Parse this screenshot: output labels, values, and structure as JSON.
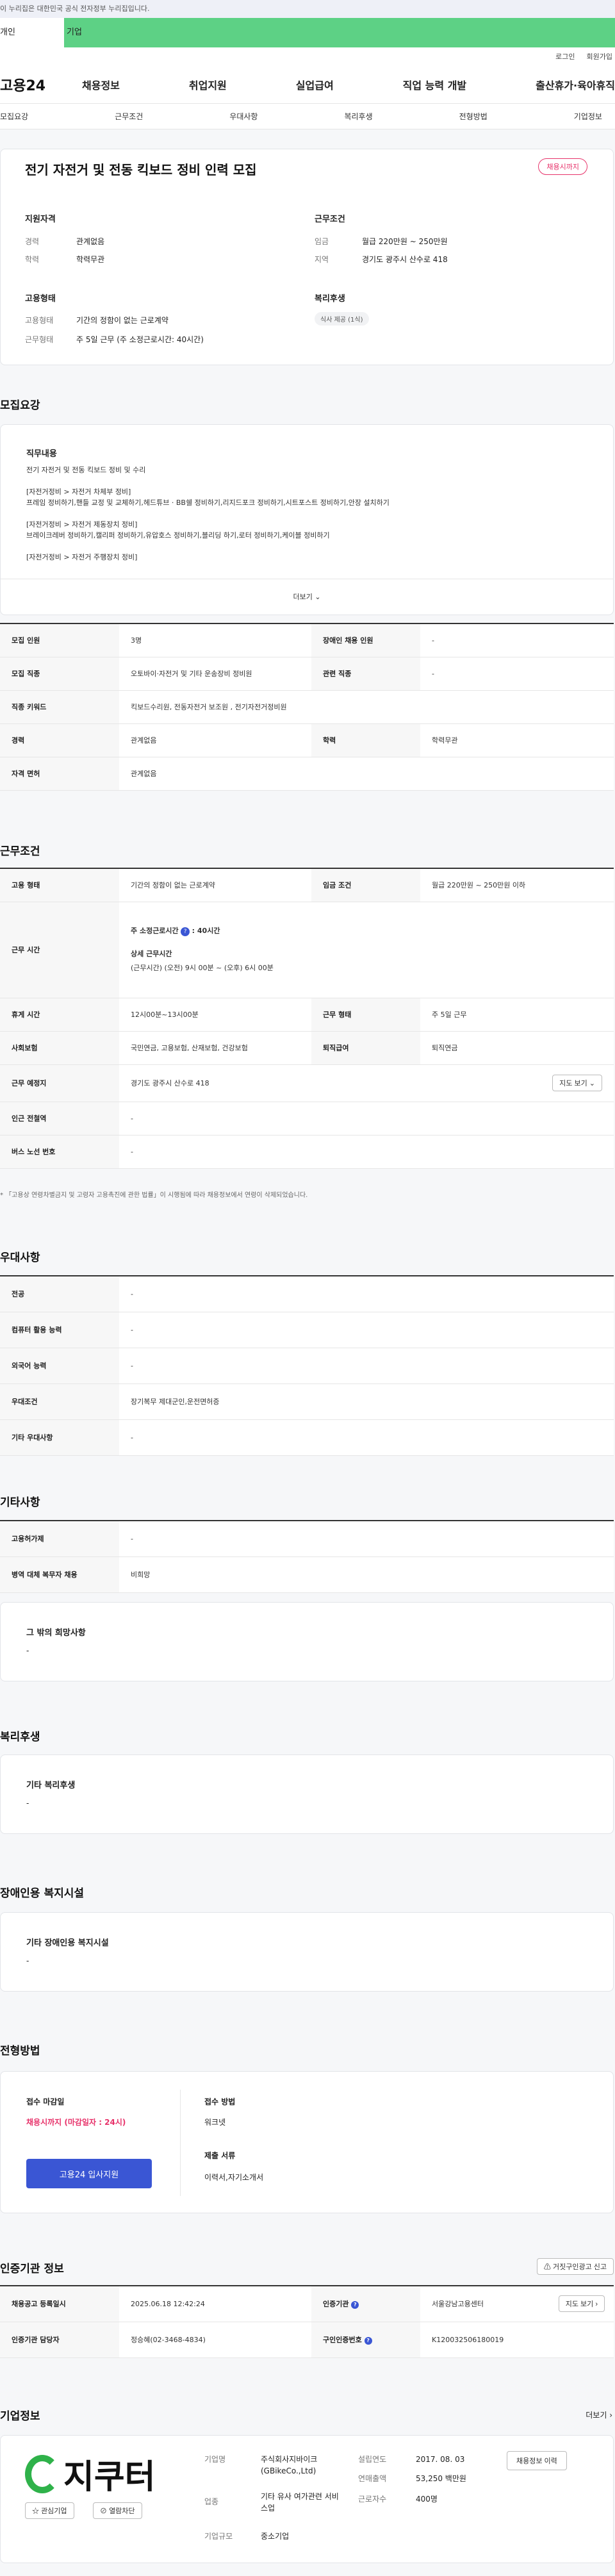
{
  "gov_banner": "이 누리집은 대한민국 공식 전자정부 누리집입니다.",
  "site_tabs": [
    "개인",
    "기업"
  ],
  "utility": [
    "로그인",
    "회원가입"
  ],
  "gnb": {
    "logo": "고용24",
    "menu": [
      "채용정보",
      "취업지원",
      "실업급여",
      "직업 능력 개발",
      "출산휴가·육아휴직"
    ]
  },
  "snb": [
    "모집요강",
    "근무조건",
    "우대사항",
    "복리후생",
    "전형방법",
    "기업정보"
  ],
  "summary": {
    "title": "전기 자전거 및 전동 킥보드 정비 인력 모집",
    "badge": "채용시까지",
    "qual_title": "지원자격",
    "qual": [
      {
        "k": "경력",
        "v": "관계없음"
      },
      {
        "k": "학력",
        "v": "학력무관"
      }
    ],
    "cond_title": "근무조건",
    "cond": [
      {
        "k": "임금",
        "v": "월급 220만원 ~ 250만원"
      },
      {
        "k": "지역",
        "v": "경기도 광주시 산수로 418"
      }
    ],
    "emp_title": "고용형태",
    "emp": [
      {
        "k": "고용형태",
        "v": "기간의 정함이 없는 근로계약"
      },
      {
        "k": "근무형태",
        "v": "주 5일 근무 (주 소정근로시간: 40시간)"
      }
    ],
    "welfare_title": "복리후생",
    "welfare_tag": "식사 제공 (1식)"
  },
  "recruit": {
    "title": "모집요강",
    "duty_title": "직무내용",
    "duty_lines": [
      "전기 자전거 및 전동 킥보드 정비 및 수리",
      "",
      "[자전거정비 > 자전거 차체부 정비]",
      "프레임 정비하기,핸들 교정 및 교체하기,헤드튜브 · BB쉘 정비하기,리지드포크 정비하기,시트포스트 정비하기,안장 설치하기",
      "",
      "[자전거정비 > 자전거 제동장치 정비]",
      "브레이크레버 정비하기,캘리퍼 정비하기,유압호스 정비하기,블리딩 하기,로터 정비하기,케이블 정비하기",
      "",
      "[자전거정비 > 자전거 주행장치 정비]"
    ],
    "more": "더보기",
    "table": [
      {
        "k1": "모집 인원",
        "v1": "3명",
        "k2": "장애인 채용 인원",
        "v2": "-"
      },
      {
        "k1": "모집 직종",
        "v1": "오토바이·자전거 및 기타 운송장비 정비원",
        "k2": "관련 직종",
        "v2": "-"
      },
      {
        "k1": "직종 키워드",
        "v1": "킥보드수리원, 전동자전거 보조원 , 전기자전거정비원",
        "k2": "",
        "v2": ""
      },
      {
        "k1": "경력",
        "v1": "관계없음",
        "k2": "학력",
        "v2": "학력무관"
      },
      {
        "k1": "자격 면허",
        "v1": "관계없음",
        "k2": "",
        "v2": ""
      }
    ]
  },
  "work": {
    "title": "근무조건",
    "emp_type_k": "고용 형태",
    "emp_type_v": "기간의 정함이 없는 근로계약",
    "wage_k": "임금 조건",
    "wage_v": "월급 220만원 ~ 250만원 이하",
    "hours_k": "근무 시간",
    "hours_label": "주 소정근로시간",
    "hours_val": ": 40시간",
    "detail_label": "상세 근무시간",
    "detail_val": "(근무시간) (오전) 9시 00분 ~ (오후) 6시 00분",
    "rest_k": "휴게 시간",
    "rest_v": "12시00분~13시00분",
    "form_k": "근무 형태",
    "form_v": "주 5일 근무",
    "ins_k": "사회보험",
    "ins_v": "국민연금, 고용보험, 산재보험, 건강보험",
    "ret_k": "퇴직급여",
    "ret_v": "퇴직연금",
    "place_k": "근무 예정지",
    "place_v": "경기도 광주시 산수로 418",
    "map_btn": "지도 보기",
    "subway_k": "인근 전철역",
    "subway_v": "-",
    "bus_k": "버스 노선 번호",
    "bus_v": "-",
    "note": "「고용상 연령차별금지 및 고령자 고용촉진에 관한 법률」이 시행됨에 따라 채용정보에서 연령이 삭제되었습니다."
  },
  "pref": {
    "title": "우대사항",
    "rows": [
      {
        "k": "전공",
        "v": "-"
      },
      {
        "k": "컴퓨터 활용 능력",
        "v": "-"
      },
      {
        "k": "외국어 능력",
        "v": "-"
      },
      {
        "k": "우대조건",
        "v": "장기복무 제대군인,운전면허증"
      },
      {
        "k": "기타 우대사항",
        "v": "-"
      }
    ]
  },
  "etc": {
    "title": "기타사항",
    "rows": [
      {
        "k": "고용허가제",
        "v": "-"
      },
      {
        "k": "병역 대체 복무자 채용",
        "v": "비희망"
      }
    ],
    "other_title": "그 밖의 희망사항",
    "other_v": "-"
  },
  "welfare": {
    "title": "복리후생",
    "sub": "기타 복리후생",
    "v": "-"
  },
  "disab": {
    "title": "장애인용 복지시설",
    "sub": "기타 장애인용 복지시설",
    "v": "-"
  },
  "process": {
    "title": "전형방법",
    "deadline_label": "접수 마감일",
    "deadline_v": "채용시까지 (마감일자 : 24시)",
    "apply_btn": "고용24 입사지원",
    "method_label": "접수 방법",
    "method_v": "워크넷",
    "docs_label": "제출 서류",
    "docs_v": "이력서,자기소개서"
  },
  "agency": {
    "title": "인증기관 정보",
    "report_btn": "거짓구인광고 신고",
    "reg_k": "채용공고 등록일시",
    "reg_v": "2025.06.18 12:42:24",
    "org_k": "인증기관",
    "org_v": "서울강남고용센터",
    "map_btn": "지도 보기",
    "mgr_k": "인증기관 담당자",
    "mgr_v": "정승혜(02-3468-4834)",
    "num_k": "구인인증번호",
    "num_v": "K120032506180019"
  },
  "company": {
    "title": "기업정보",
    "more": "더보기",
    "logo_text": "지쿠터",
    "fav_btn": "관심기업",
    "block_btn": "열람차단",
    "name_k": "기업명",
    "name_v": "주식회사지바이크 (GBikeCo.,Ltd)",
    "ind_k": "업종",
    "ind_v": "기타 유사 여가관련 서비스업",
    "size_k": "기업규모",
    "size_v": "중소기업",
    "est_k": "설립연도",
    "est_v": "2017. 08. 03",
    "sales_k": "연매출액",
    "sales_v": "53,250 백만원",
    "emp_k": "근로자수",
    "emp_v": "400명",
    "jobs_btn": "채용정보 이력",
    "colors": {
      "brand_green": "#2fb24a",
      "accent_blue": "#3a56d4",
      "accent_pink": "#e7326a"
    }
  }
}
